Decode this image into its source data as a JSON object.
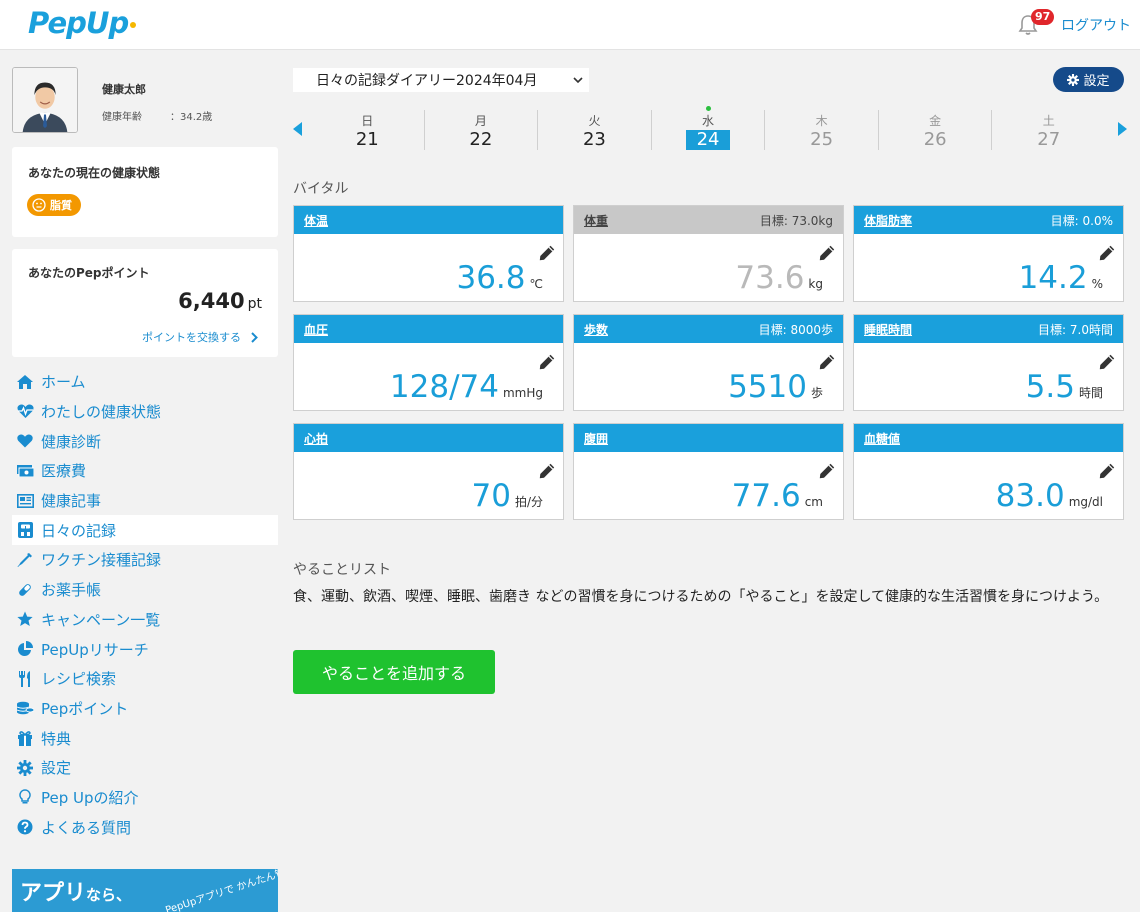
{
  "header": {
    "logo": "PepUp",
    "notification_count": "97",
    "logout_label": "ログアウト"
  },
  "profile": {
    "name": "健康太郎",
    "age_label": "健康年齢",
    "age_value": "：34.2歳"
  },
  "health_status": {
    "title": "あなたの現在の健康状態",
    "badge": "脂質"
  },
  "points": {
    "title": "あなたのPepポイント",
    "value": "6,440",
    "unit": "pt",
    "exchange_label": "ポイントを交換する"
  },
  "nav": {
    "items": [
      {
        "label": "ホーム",
        "icon": "home-icon"
      },
      {
        "label": "わたしの健康状態",
        "icon": "heartbeat-icon"
      },
      {
        "label": "健康診断",
        "icon": "heart-icon"
      },
      {
        "label": "医療費",
        "icon": "money-icon"
      },
      {
        "label": "健康記事",
        "icon": "newspaper-icon"
      },
      {
        "label": "日々の記録",
        "icon": "scale-icon",
        "active": true
      },
      {
        "label": "ワクチン接種記録",
        "icon": "syringe-icon"
      },
      {
        "label": "お薬手帳",
        "icon": "pill-icon"
      },
      {
        "label": "キャンペーン一覧",
        "icon": "star-icon"
      },
      {
        "label": "PepUpリサーチ",
        "icon": "pie-chart-icon"
      },
      {
        "label": "レシピ検索",
        "icon": "utensils-icon"
      },
      {
        "label": "Pepポイント",
        "icon": "coins-icon"
      },
      {
        "label": "特典",
        "icon": "gift-icon"
      },
      {
        "label": "設定",
        "icon": "gear-icon"
      },
      {
        "label": "Pep Upの紹介",
        "icon": "lightbulb-icon"
      },
      {
        "label": "よくある質問",
        "icon": "question-icon"
      }
    ]
  },
  "banner": {
    "text_main": "アプリ",
    "text_small": "なら、",
    "text_side": "PepUpアプリで かんたん管理"
  },
  "diary": {
    "selected": "日々の記録ダイアリー2024年04月"
  },
  "settings_label": "設定",
  "week": {
    "days": [
      {
        "weekday": "日",
        "date": "21"
      },
      {
        "weekday": "月",
        "date": "22"
      },
      {
        "weekday": "火",
        "date": "23"
      },
      {
        "weekday": "水",
        "date": "24",
        "selected": true
      },
      {
        "weekday": "木",
        "date": "25",
        "future": true
      },
      {
        "weekday": "金",
        "date": "26",
        "future": true
      },
      {
        "weekday": "土",
        "date": "27",
        "future": true
      }
    ]
  },
  "vitals": {
    "section_label": "バイタル",
    "cards": [
      {
        "title": "体温",
        "goal": "",
        "value": "36.8",
        "unit": "℃"
      },
      {
        "title": "体重",
        "goal": "目標: 73.0kg",
        "value": "73.6",
        "unit": "kg",
        "disabled": true
      },
      {
        "title": "体脂肪率",
        "goal": "目標: 0.0%",
        "value": "14.2",
        "unit": "%"
      },
      {
        "title": "血圧",
        "goal": "",
        "value": "128/74",
        "unit": "mmHg"
      },
      {
        "title": "歩数",
        "goal": "目標: 8000歩",
        "value": "5510",
        "unit": "歩"
      },
      {
        "title": "睡眠時間",
        "goal": "目標: 7.0時間",
        "value": "5.5",
        "unit": "時間"
      },
      {
        "title": "心拍",
        "goal": "",
        "value": "70",
        "unit": "拍/分"
      },
      {
        "title": "腹囲",
        "goal": "",
        "value": "77.6",
        "unit": "cm"
      },
      {
        "title": "血糖値",
        "goal": "",
        "value": "83.0",
        "unit": "mg/dl"
      }
    ]
  },
  "todo": {
    "section_label": "やることリスト",
    "description": "食、運動、飲酒、喫煙、睡眠、歯磨き などの習慣を身につけるための「やること」を設定して健康的な生活習慣を身につけよう。",
    "add_button": "やることを追加する"
  }
}
